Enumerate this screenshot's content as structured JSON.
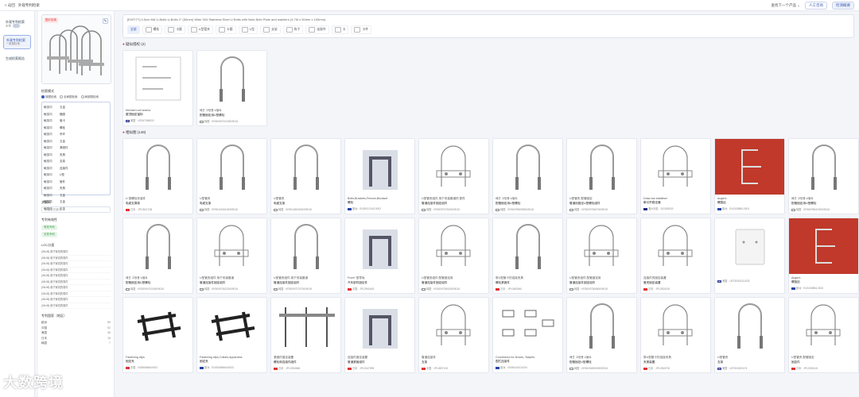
{
  "topbar": {
    "back": "< 返回",
    "title": "外观专利检索",
    "history": "查找下一个产品 ⌄",
    "btn1": "人工咨询",
    "btn2": "检测概要"
  },
  "leftnav": [
    {
      "label": "外观专利检索",
      "sub": "去检",
      "active": false
    },
    {
      "label": "外观专利检索",
      "sub": "+ 新建检索",
      "active": true
    },
    {
      "label": "生成检索报告",
      "sub": "",
      "active": false
    }
  ],
  "filters": {
    "query_badge": "图片检索",
    "match_title": "检索模式",
    "match_options": [
      "按图检索",
      "全局图检索",
      "局部图检索"
    ],
    "loc_title": "LOC 类别",
    "categories": [
      [
        "敏感词",
        "五金"
      ],
      [
        "敏感词",
        "箍圈"
      ],
      [
        "敏感词",
        "管卡"
      ],
      [
        "敏感词",
        "螺栓"
      ],
      [
        "敏感词",
        "吊环"
      ],
      [
        "敏感词",
        "五金"
      ],
      [
        "敏感词",
        "紧固件"
      ],
      [
        "敏感词",
        "夹具"
      ],
      [
        "敏感词",
        "支架"
      ],
      [
        "敏感词",
        "连接件"
      ],
      [
        "敏感词",
        "U型"
      ],
      [
        "敏感词",
        "管件"
      ],
      [
        "敏感词",
        "夹具"
      ],
      [
        "敏感词",
        "五金"
      ],
      [
        "敏感词",
        "五金"
      ],
      [
        "敏感词",
        "五金"
      ]
    ],
    "keyword_title": "关键词",
    "keyword_placeholder": "请搜索关键词",
    "status_title": "专利有效性",
    "status_tags": [
      "有效专利",
      "无效专利"
    ],
    "loc_class_title": "LOC分类",
    "loc_items": [
      "(08-08) 用于家具的零件",
      "(08-08) 用于家具的零件",
      "(08-08) 用于家具的零件",
      "(08-08) 用于家具的零件",
      "(08-08) 用于家具的零件",
      "(08-08) 用于家具的零件",
      "(08-08) 用于家具的零件",
      "(08-08) 用于家具的零件",
      "(08-08) 用于家具的零件",
      "(08-08) 用于家具的零件"
    ],
    "country_title": "专利国家（地区）",
    "countries": [
      {
        "name": "欧洲",
        "count": "89"
      },
      {
        "name": "中国",
        "count": "52"
      },
      {
        "name": "美国",
        "count": "36"
      },
      {
        "name": "日本",
        "count": "18"
      },
      {
        "name": "韩国",
        "count": "7"
      }
    ]
  },
  "search": {
    "query": "[ENTITY] 4.5cm M6 U-Bolts U-Bolts 2\" (50mm) Wide 304 Stainless Steel U Bolts with Nuts Both Plate and washers (4.7M x 50mm x 100mm)",
    "chips": [
      "全部",
      "螺栓",
      "卡箍",
      "U型管夹",
      "卡箍",
      "U型",
      "支架",
      "钩子",
      "连接件",
      "卡",
      "卡件"
    ]
  },
  "section1": {
    "title": "疑似侵权",
    "count": "(2)"
  },
  "section2": {
    "title": "相似图",
    "count": "(148)"
  },
  "row1": [
    {
      "t1": "Michael roof anchor",
      "t2": "屋顶固定锚钩",
      "t3": "美国 · US247948000",
      "flag": "us",
      "img": "doc"
    },
    {
      "t1": "배관 고정용 U볼트",
      "t2": "配管固定用U型螺栓",
      "t3": "韩国 · KR3009470218009015",
      "flag": "kr",
      "img": "ubolt"
    }
  ],
  "row2": [
    {
      "t1": "U 型螺栓安装件",
      "t2": "电缆支撑架",
      "t3": "日本 · JP10547138",
      "flag": "cn",
      "img": "ubolt"
    },
    {
      "t1": "U型管夹",
      "t2": "电缆支架",
      "t3": "韩国 · KR3011943100009015",
      "flag": "kr",
      "img": "ubolt"
    },
    {
      "t1": "U型管夹",
      "t2": "电缆支架",
      "t3": "韩国 · KR3011863000009015",
      "flag": "kr",
      "img": "ubolt"
    },
    {
      "t1": "Bolts,Brackets,Fences,Blockset",
      "t2": "螺栓",
      "t3": "欧洲 · EU00012145-0002",
      "flag": "eu",
      "img": "gray"
    },
    {
      "t1": "U型管夹组件 用于安装管道的 配件",
      "t2": "管道连接件固定组件",
      "t3": "韩国 · KR3009737820009015",
      "flag": "kr",
      "img": "clamp"
    },
    {
      "t1": "배관 고정용 U볼트",
      "t2": "配管固定用U型螺栓",
      "t3": "韩国 · KR3009950980009015",
      "flag": "kr",
      "img": "ubolt"
    },
    {
      "t1": "U型管夹 配管固定",
      "t2": "管道用固定U型螺栓组件",
      "t3": "韩国 · KR3009736570009015",
      "flag": "kr",
      "img": "ubolt"
    },
    {
      "t1": "Draw-bar stabiliser",
      "t2": "牵引杆稳定器",
      "t3": "澳大利亚 · 202428030",
      "flag": "au",
      "img": "clamp"
    },
    {
      "t1": "Augers",
      "t2": "螺旋钻",
      "t3": "欧洲 · EU0108854-0001",
      "flag": "eu",
      "img": "red"
    },
    {
      "t1": "배관 고정용 U볼트",
      "t2": "配管固定用U型螺栓",
      "t3": "韩国 · KR3009954190009015",
      "flag": "kr",
      "img": "ubolt"
    }
  ],
  "row3": [
    {
      "t1": "배관 고정용 U볼트",
      "t2": "配管固定用U型螺栓",
      "t3": "韩国 · KR3009470218009015",
      "flag": "kr",
      "img": "ubolt"
    },
    {
      "t1": "U型管夹组件 用于安装管道",
      "t2": "管道连接件固定组件",
      "t3": "韩国 · KR3009736220009015",
      "flag": "kr",
      "img": "clamp"
    },
    {
      "t1": "U型管夹组件 用于安装管道",
      "t2": "管道连接件固定组件",
      "t3": "韩国 · KR3009737070009015",
      "flag": "kr",
      "img": "ubolt"
    },
    {
      "t1": "Front* 型导轨",
      "t2": "汽车部件固定件",
      "t3": "中国 · JP12990463",
      "flag": "cn",
      "img": "gray"
    },
    {
      "t1": "U型管夹组件 配管固定用",
      "t2": "管道连接件固定组件",
      "t3": "韩国 · KR3009736920009015",
      "flag": "kr",
      "img": "clamp"
    },
    {
      "t1": "带U型管卡的连接夹具",
      "t2": "螺栓紧固件",
      "t3": "日本 · JP10483940",
      "flag": "cn",
      "img": "ubolt"
    },
    {
      "t1": "U型管夹组件 配管固定用",
      "t2": "管道连接件固定组件",
      "t3": "韩国 · KR3009736680009015",
      "flag": "kr",
      "img": "clamp"
    },
    {
      "t1": "连接件的固定装置",
      "t2": "管夹固定装置",
      "t3": "日本 · JP12530200",
      "flag": "cn",
      "img": "clamp"
    },
    {
      "t1": "",
      "t2": "",
      "t3": "美国 · US730002111033",
      "flag": "us",
      "img": "plate"
    },
    {
      "t1": "Augers",
      "t2": "螺旋钻",
      "t3": "欧洲 · EU0108854-0002",
      "flag": "eu",
      "img": "red"
    }
  ],
  "row4": [
    {
      "t1": "Fastening clips",
      "t2": "固定夹",
      "t3": "中国 · 00055566640002",
      "flag": "cn",
      "img": "black"
    },
    {
      "t1": "Fastening clips,Collars,Apparatus",
      "t2": "固定夹",
      "t3": "欧洲 · EU0055566640003",
      "flag": "eu",
      "img": "black"
    },
    {
      "t1": "紧固件固定装置",
      "t2": "螺栓和连接件组件",
      "t3": "日本 · JP12394566",
      "flag": "cn",
      "img": "bolts"
    },
    {
      "t1": "连接件固定装置",
      "t2": "管道紧固组件",
      "t3": "日本 · JP12347999",
      "flag": "cn",
      "img": "gray"
    },
    {
      "t1": "管道连接件",
      "t2": "支架",
      "t3": "中国 · JP12697100",
      "flag": "cn",
      "img": "clamp"
    },
    {
      "t1": "Connectors for fences, Staples",
      "t2": "围栏连接件",
      "t3": "欧洲 · 00054441011004",
      "flag": "eu",
      "img": "parts"
    },
    {
      "t1": "배관 고정용 U볼트",
      "t2": "配管固定U型螺栓",
      "t3": "韩国 · KR3009495000009015",
      "flag": "kr",
      "img": "ubolt"
    },
    {
      "t1": "带U型管卡的连接夹具",
      "t2": "夹紧装置",
      "t3": "日本 · JP12350700",
      "flag": "cn",
      "img": "clamp"
    },
    {
      "t1": "U型管夹",
      "t2": "支架",
      "t3": "美国 · US7300001074",
      "flag": "us",
      "img": "ubolt"
    },
    {
      "t1": "U型管夹 配管固定",
      "t2": "固定件",
      "t3": "日本 · JP12335115",
      "flag": "cn",
      "img": "clamp"
    }
  ],
  "watermark": "大数跨境"
}
